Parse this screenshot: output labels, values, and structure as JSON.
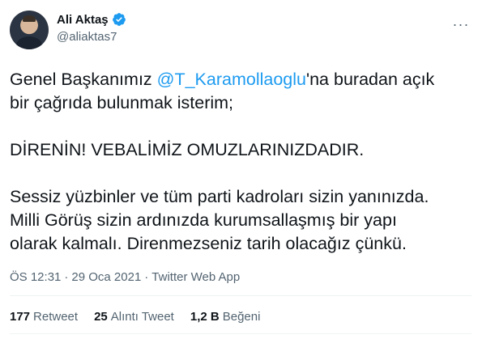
{
  "author": {
    "name": "Ali Aktaş",
    "handle": "@aliaktas7",
    "verified": true,
    "avatar_icon": "profile-photo"
  },
  "more_icon": "ellipsis-icon",
  "tweet": {
    "text_before_mention": "Genel Başkanımız ",
    "mention": "@T_Karamollaoglu",
    "text_after_mention": "'na buradan açık\nbir çağrıda bulunmak isterim;\n\nDİRENİN! VEBALİMİZ OMUZLARINIZDADIR.\n\nSessiz yüzbinler ve tüm parti kadroları sizin yanınızda.\nMilli Görüş sizin ardınızda kurumsallaşmış bir yapı\nolarak kalmalı. Direnmezseniz tarih olacağız çünkü."
  },
  "meta": {
    "time": "ÖS 12:31",
    "separator1": "·",
    "date": "29 Oca 2021",
    "separator2": "·",
    "source": "Twitter Web App"
  },
  "stats": {
    "retweets_count": "177",
    "retweets_label": "Retweet",
    "quotes_count": "25",
    "quotes_label": "Alıntı Tweet",
    "likes_count": "1,2 B",
    "likes_label": "Beğeni"
  },
  "colors": {
    "accent": "#1d9bf0",
    "secondary_text": "#536471",
    "primary_text": "#0f1419"
  }
}
